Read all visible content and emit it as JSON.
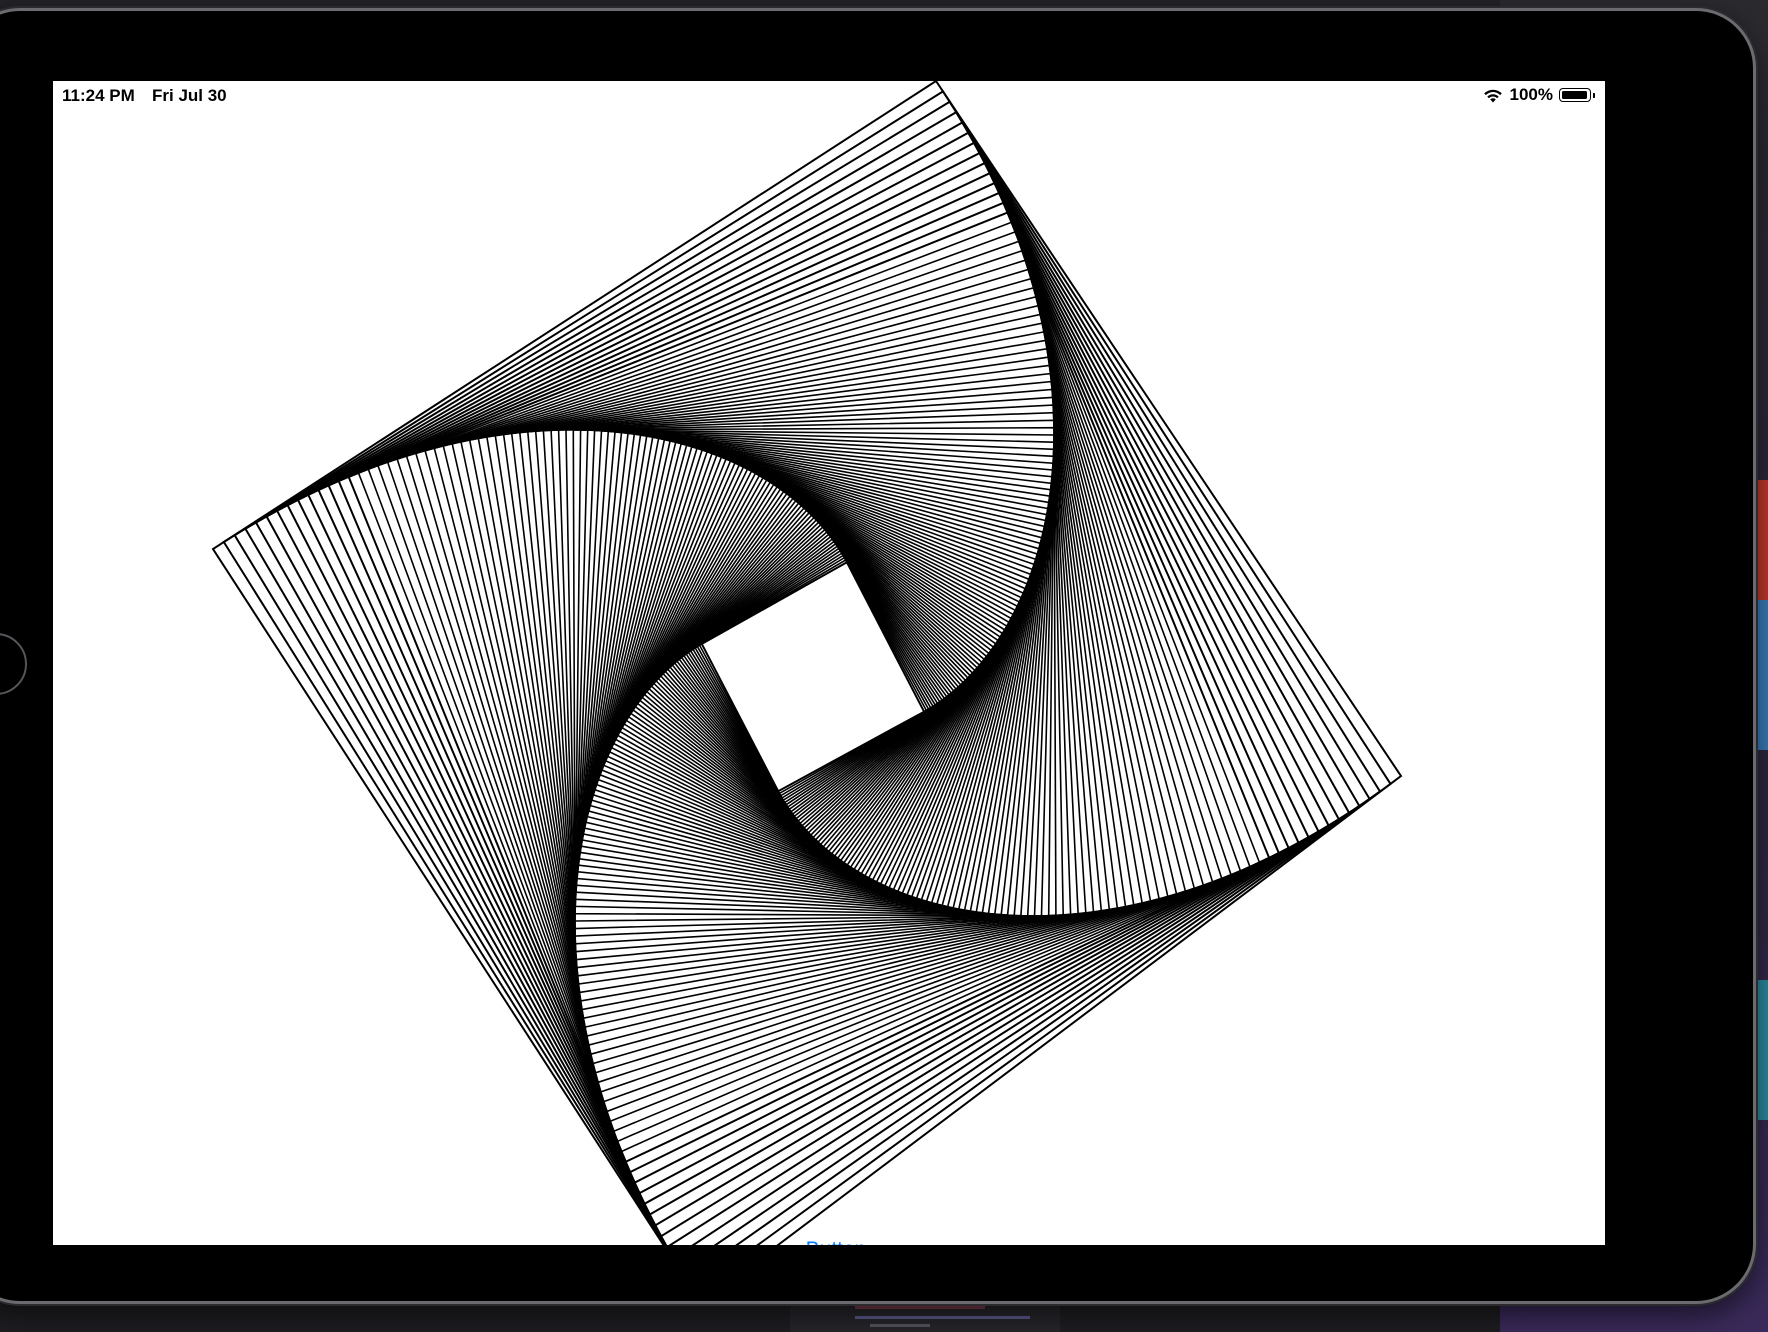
{
  "status_bar": {
    "time": "11:24 PM",
    "date": "Fri Jul 30",
    "battery_percent": "100%",
    "battery_level": 1.0
  },
  "button": {
    "label": "Button",
    "color": "#0a7aff"
  },
  "artwork": {
    "description_icon": "nested-rotated-squares",
    "line_color": "#000000",
    "background": "#ffffff"
  }
}
